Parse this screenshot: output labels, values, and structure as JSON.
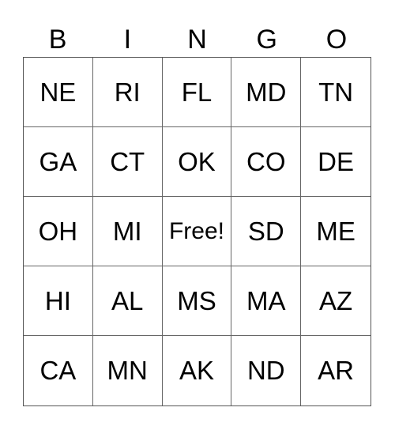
{
  "header": [
    "B",
    "I",
    "N",
    "G",
    "O"
  ],
  "rows": [
    [
      "NE",
      "RI",
      "FL",
      "MD",
      "TN"
    ],
    [
      "GA",
      "CT",
      "OK",
      "CO",
      "DE"
    ],
    [
      "OH",
      "MI",
      "Free!",
      "SD",
      "ME"
    ],
    [
      "HI",
      "AL",
      "MS",
      "MA",
      "AZ"
    ],
    [
      "CA",
      "MN",
      "AK",
      "ND",
      "AR"
    ]
  ]
}
